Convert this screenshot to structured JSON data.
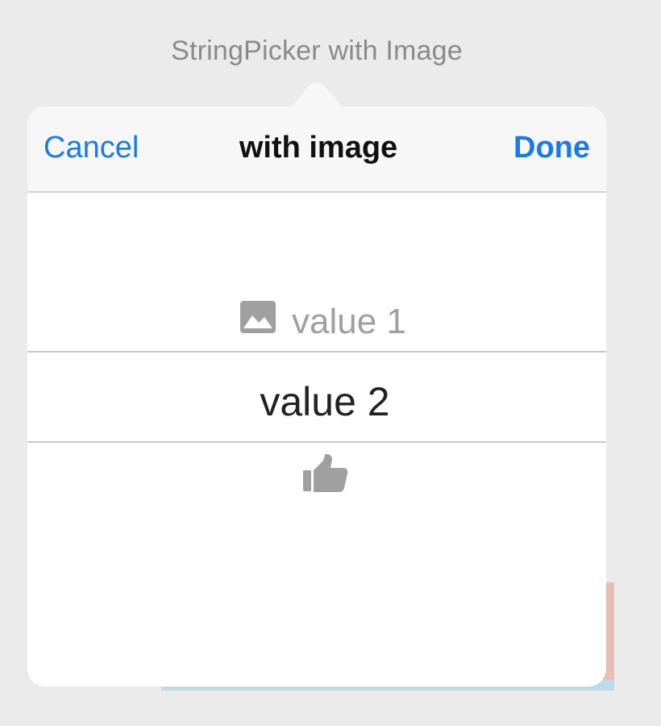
{
  "source_button": {
    "title": "StringPicker with Image"
  },
  "picker": {
    "toolbar": {
      "cancel_label": "Cancel",
      "title": "with image",
      "done_label": "Done"
    },
    "rows": [
      {
        "label": "value 1",
        "icon": "image-icon",
        "state": "above-selection"
      },
      {
        "label": "value 2",
        "icon": "",
        "state": "selected"
      },
      {
        "label": "",
        "icon": "thumbs-up-icon",
        "state": "below-selection"
      }
    ]
  },
  "colors": {
    "accent": "#1a7ae8",
    "background": "#ebebeb",
    "toolbar": "#f7f7f7",
    "selected_text": "#222222",
    "dimmed_text": "#a0a0a0",
    "divider": "#c8c8ca"
  }
}
